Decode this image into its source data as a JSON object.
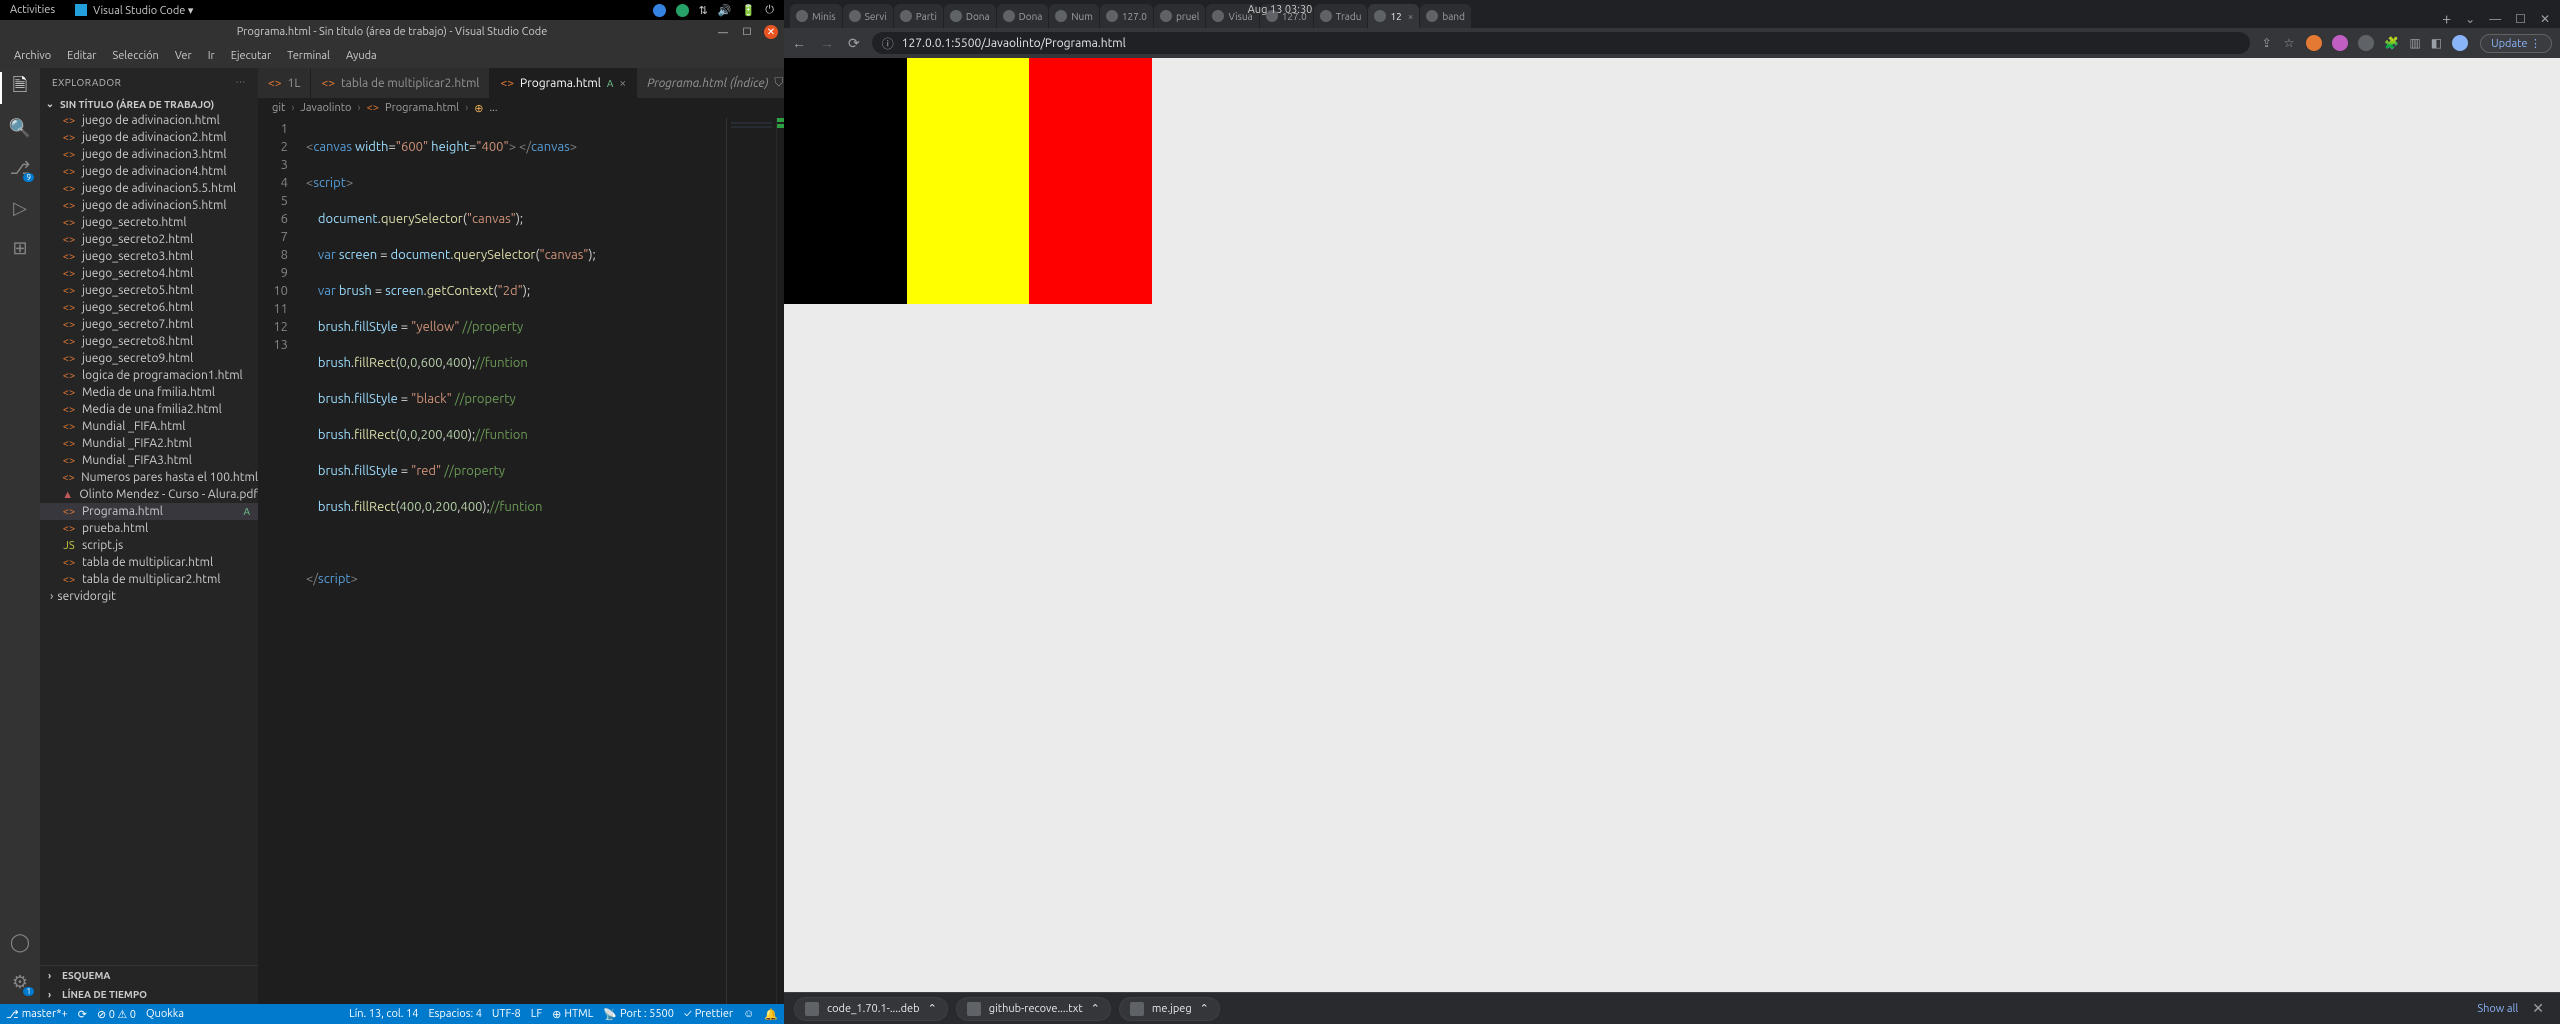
{
  "gnome": {
    "activities": "Activities",
    "app": "Visual Studio Code ▾",
    "clock": "Aug 13  03:30"
  },
  "vscode": {
    "title": "Programa.html - Sin título (área de trabajo) - Visual Studio Code",
    "menu": [
      "Archivo",
      "Editar",
      "Selección",
      "Ver",
      "Ir",
      "Ejecutar",
      "Terminal",
      "Ayuda"
    ],
    "explorer_label": "EXPLORADOR",
    "workspace": "SIN TÍTULO (ÁREA DE TRABAJO)",
    "files": [
      {
        "name": "juego de adivinacion.html",
        "icon": "<>"
      },
      {
        "name": "juego de adivinacion2.html",
        "icon": "<>"
      },
      {
        "name": "juego de adivinacion3.html",
        "icon": "<>"
      },
      {
        "name": "juego de adivinacion4.html",
        "icon": "<>"
      },
      {
        "name": "juego de adivinacion5.5.html",
        "icon": "<>"
      },
      {
        "name": "juego de adivinacion5.html",
        "icon": "<>"
      },
      {
        "name": "juego_secreto.html",
        "icon": "<>"
      },
      {
        "name": "juego_secreto2.html",
        "icon": "<>"
      },
      {
        "name": "juego_secreto3.html",
        "icon": "<>"
      },
      {
        "name": "juego_secreto4.html",
        "icon": "<>"
      },
      {
        "name": "juego_secreto5.html",
        "icon": "<>"
      },
      {
        "name": "juego_secreto6.html",
        "icon": "<>"
      },
      {
        "name": "juego_secreto7.html",
        "icon": "<>"
      },
      {
        "name": "juego_secreto8.html",
        "icon": "<>"
      },
      {
        "name": "juego_secreto9.html",
        "icon": "<>"
      },
      {
        "name": "logica de programacion1.html",
        "icon": "<>"
      },
      {
        "name": "Media de una fmilia.html",
        "icon": "<>"
      },
      {
        "name": "Media de una fmilia2.html",
        "icon": "<>"
      },
      {
        "name": "Mundial _FIFA.html",
        "icon": "<>"
      },
      {
        "name": "Mundial _FIFA2.html",
        "icon": "<>"
      },
      {
        "name": "Mundial _FIFA3.html",
        "icon": "<>"
      },
      {
        "name": "Numeros pares hasta el 100.html",
        "icon": "<>"
      },
      {
        "name": "Olinto Mendez - Curso - Alura.pdf",
        "icon": "▲",
        "cls": "pdf"
      },
      {
        "name": "Programa.html",
        "icon": "<>",
        "sel": true,
        "mod": "A"
      },
      {
        "name": "prueba.html",
        "icon": "<>"
      },
      {
        "name": "script.js",
        "icon": "JS",
        "cls": "js"
      },
      {
        "name": "tabla de multiplicar.html",
        "icon": "<>"
      },
      {
        "name": "tabla de multiplicar2.html",
        "icon": "<>"
      }
    ],
    "folder": "servidorgit",
    "outline": "ESQUEMA",
    "timeline": "LÍNEA DE TIEMPO",
    "tabs": [
      {
        "label": "1L"
      },
      {
        "label": "tabla de multiplicar2.html"
      },
      {
        "label": "Programa.html",
        "mod": "A",
        "active": true,
        "close": "×"
      },
      {
        "label": "Programa.html (Índice)",
        "italic": true,
        "lock": true
      }
    ],
    "breadcrumb": {
      "a": "git",
      "b": "Javaolinto",
      "c": "Programa.html",
      "d": "..."
    },
    "status": {
      "branch": "master*+",
      "sync": "⟳",
      "errors": "⊘ 0 ⚠ 0",
      "quokka": "Quokka",
      "pos": "Lín. 13, col. 14",
      "spaces": "Espacios: 4",
      "enc": "UTF-8",
      "eol": "LF",
      "lang": "HTML",
      "port": "Port : 5500",
      "prettier": "Prettier"
    }
  },
  "chrome": {
    "tabs": [
      {
        "t": "Minis"
      },
      {
        "t": "Servi"
      },
      {
        "t": "Parti"
      },
      {
        "t": "Dona"
      },
      {
        "t": "Dona"
      },
      {
        "t": "Num"
      },
      {
        "t": "127.0"
      },
      {
        "t": "pruel"
      },
      {
        "t": "Visua"
      },
      {
        "t": "127.0"
      },
      {
        "t": "Tradu"
      },
      {
        "t": "12",
        "active": true,
        "close": "×"
      },
      {
        "t": "band"
      }
    ],
    "url": "127.0.0.1:5500/Javaolinto/Programa.html",
    "update": "Update ⋮",
    "downloads": [
      {
        "t": "code_1.70.1-....deb"
      },
      {
        "t": "github-recove....txt"
      },
      {
        "t": "me.jpeg"
      }
    ],
    "showall": "Show all"
  }
}
